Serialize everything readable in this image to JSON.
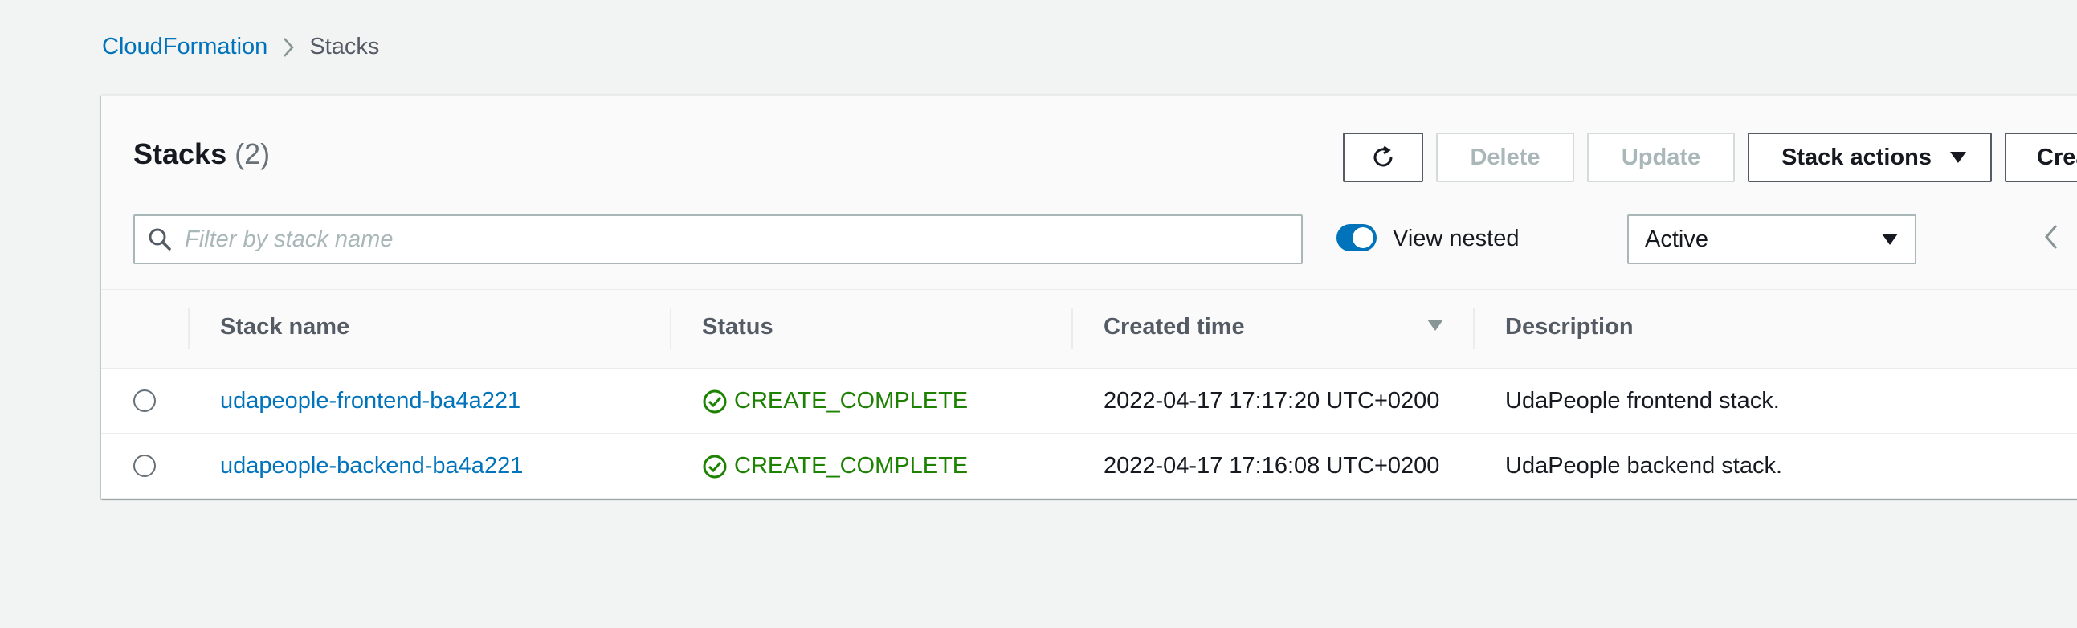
{
  "breadcrumb": {
    "root": "CloudFormation",
    "current": "Stacks"
  },
  "header": {
    "title": "Stacks",
    "count": "(2)"
  },
  "toolbar": {
    "refresh_icon": "refresh-icon",
    "delete_label": "Delete",
    "update_label": "Update",
    "stack_actions_label": "Stack actions",
    "create_label": "Crea"
  },
  "filter": {
    "placeholder": "Filter by stack name",
    "value": ""
  },
  "view_nested": {
    "label": "View nested",
    "enabled": true
  },
  "status_filter": {
    "selected": "Active"
  },
  "table": {
    "columns": {
      "stack_name": "Stack name",
      "status": "Status",
      "created_time": "Created time",
      "description": "Description"
    },
    "rows": [
      {
        "stack_name": "udapeople-frontend-ba4a221",
        "status": "CREATE_COMPLETE",
        "created_time": "2022-04-17 17:17:20 UTC+0200",
        "description": "UdaPeople frontend stack."
      },
      {
        "stack_name": "udapeople-backend-ba4a221",
        "status": "CREATE_COMPLETE",
        "created_time": "2022-04-17 17:16:08 UTC+0200",
        "description": "UdaPeople backend stack."
      }
    ]
  },
  "colors": {
    "link": "#0073bb",
    "success": "#1d8102",
    "toggle": "#0073bb",
    "background": "#f2f3f3"
  }
}
